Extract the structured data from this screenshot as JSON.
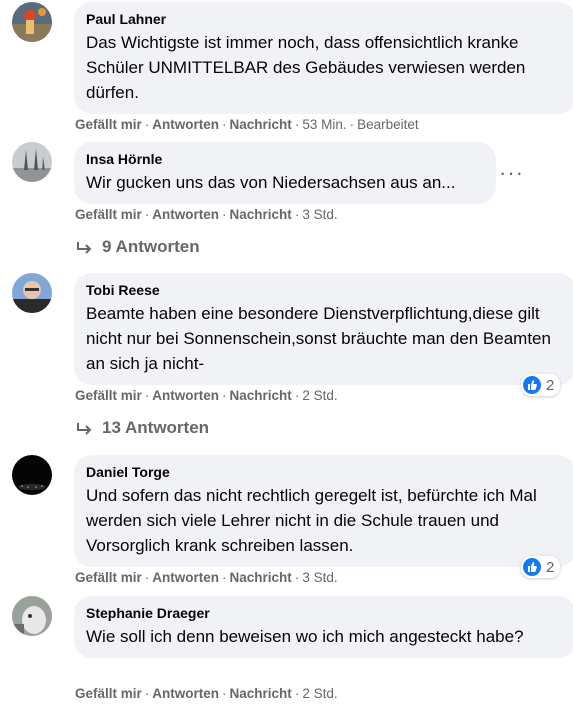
{
  "comments": [
    {
      "author": "Paul Lahner",
      "text": "Das Wichtigste ist immer noch, dass offensichtlich kranke Schüler UNMITTELBAR des Gebäudes verwiesen werden dürfen.",
      "like": "Gefällt mir",
      "reply": "Antworten",
      "message": "Nachricht",
      "time": "53 Min.",
      "edited": "Bearbeitet"
    },
    {
      "author": "Insa Hörnle",
      "text": "Wir gucken uns das von Niedersachsen aus an...",
      "like": "Gefällt mir",
      "reply": "Antworten",
      "message": "Nachricht",
      "time": "3 Std.",
      "more": "···",
      "replies": "9 Antworten"
    },
    {
      "author": "Tobi Reese",
      "text": "Beamte haben eine besondere Dienstverpflichtung,diese gilt nicht nur bei Sonnenschein,sonst bräuchte man den Beamten an sich ja nicht-",
      "like": "Gefällt mir",
      "reply": "Antworten",
      "message": "Nachricht",
      "time": "2 Std.",
      "reaction_count": "2",
      "replies": "13 Antworten"
    },
    {
      "author": "Daniel Torge",
      "text": "Und sofern das nicht rechtlich geregelt ist, befürchte ich Mal werden sich viele Lehrer nicht in die Schule trauen und Vorsorglich krank schreiben lassen.",
      "like": "Gefällt mir",
      "reply": "Antworten",
      "message": "Nachricht",
      "time": "3 Std.",
      "reaction_count": "2"
    },
    {
      "author": "Stephanie Draeger",
      "text": "Wie soll ich denn beweisen wo ich mich angesteckt habe?",
      "like": "Gefällt mir",
      "reply": "Antworten",
      "message": "Nachricht",
      "time": "2 Std."
    }
  ],
  "separator": "·",
  "colors": {
    "bubble": "#f0f2f5",
    "meta": "#65676b",
    "like_blue": "#1877f2"
  }
}
